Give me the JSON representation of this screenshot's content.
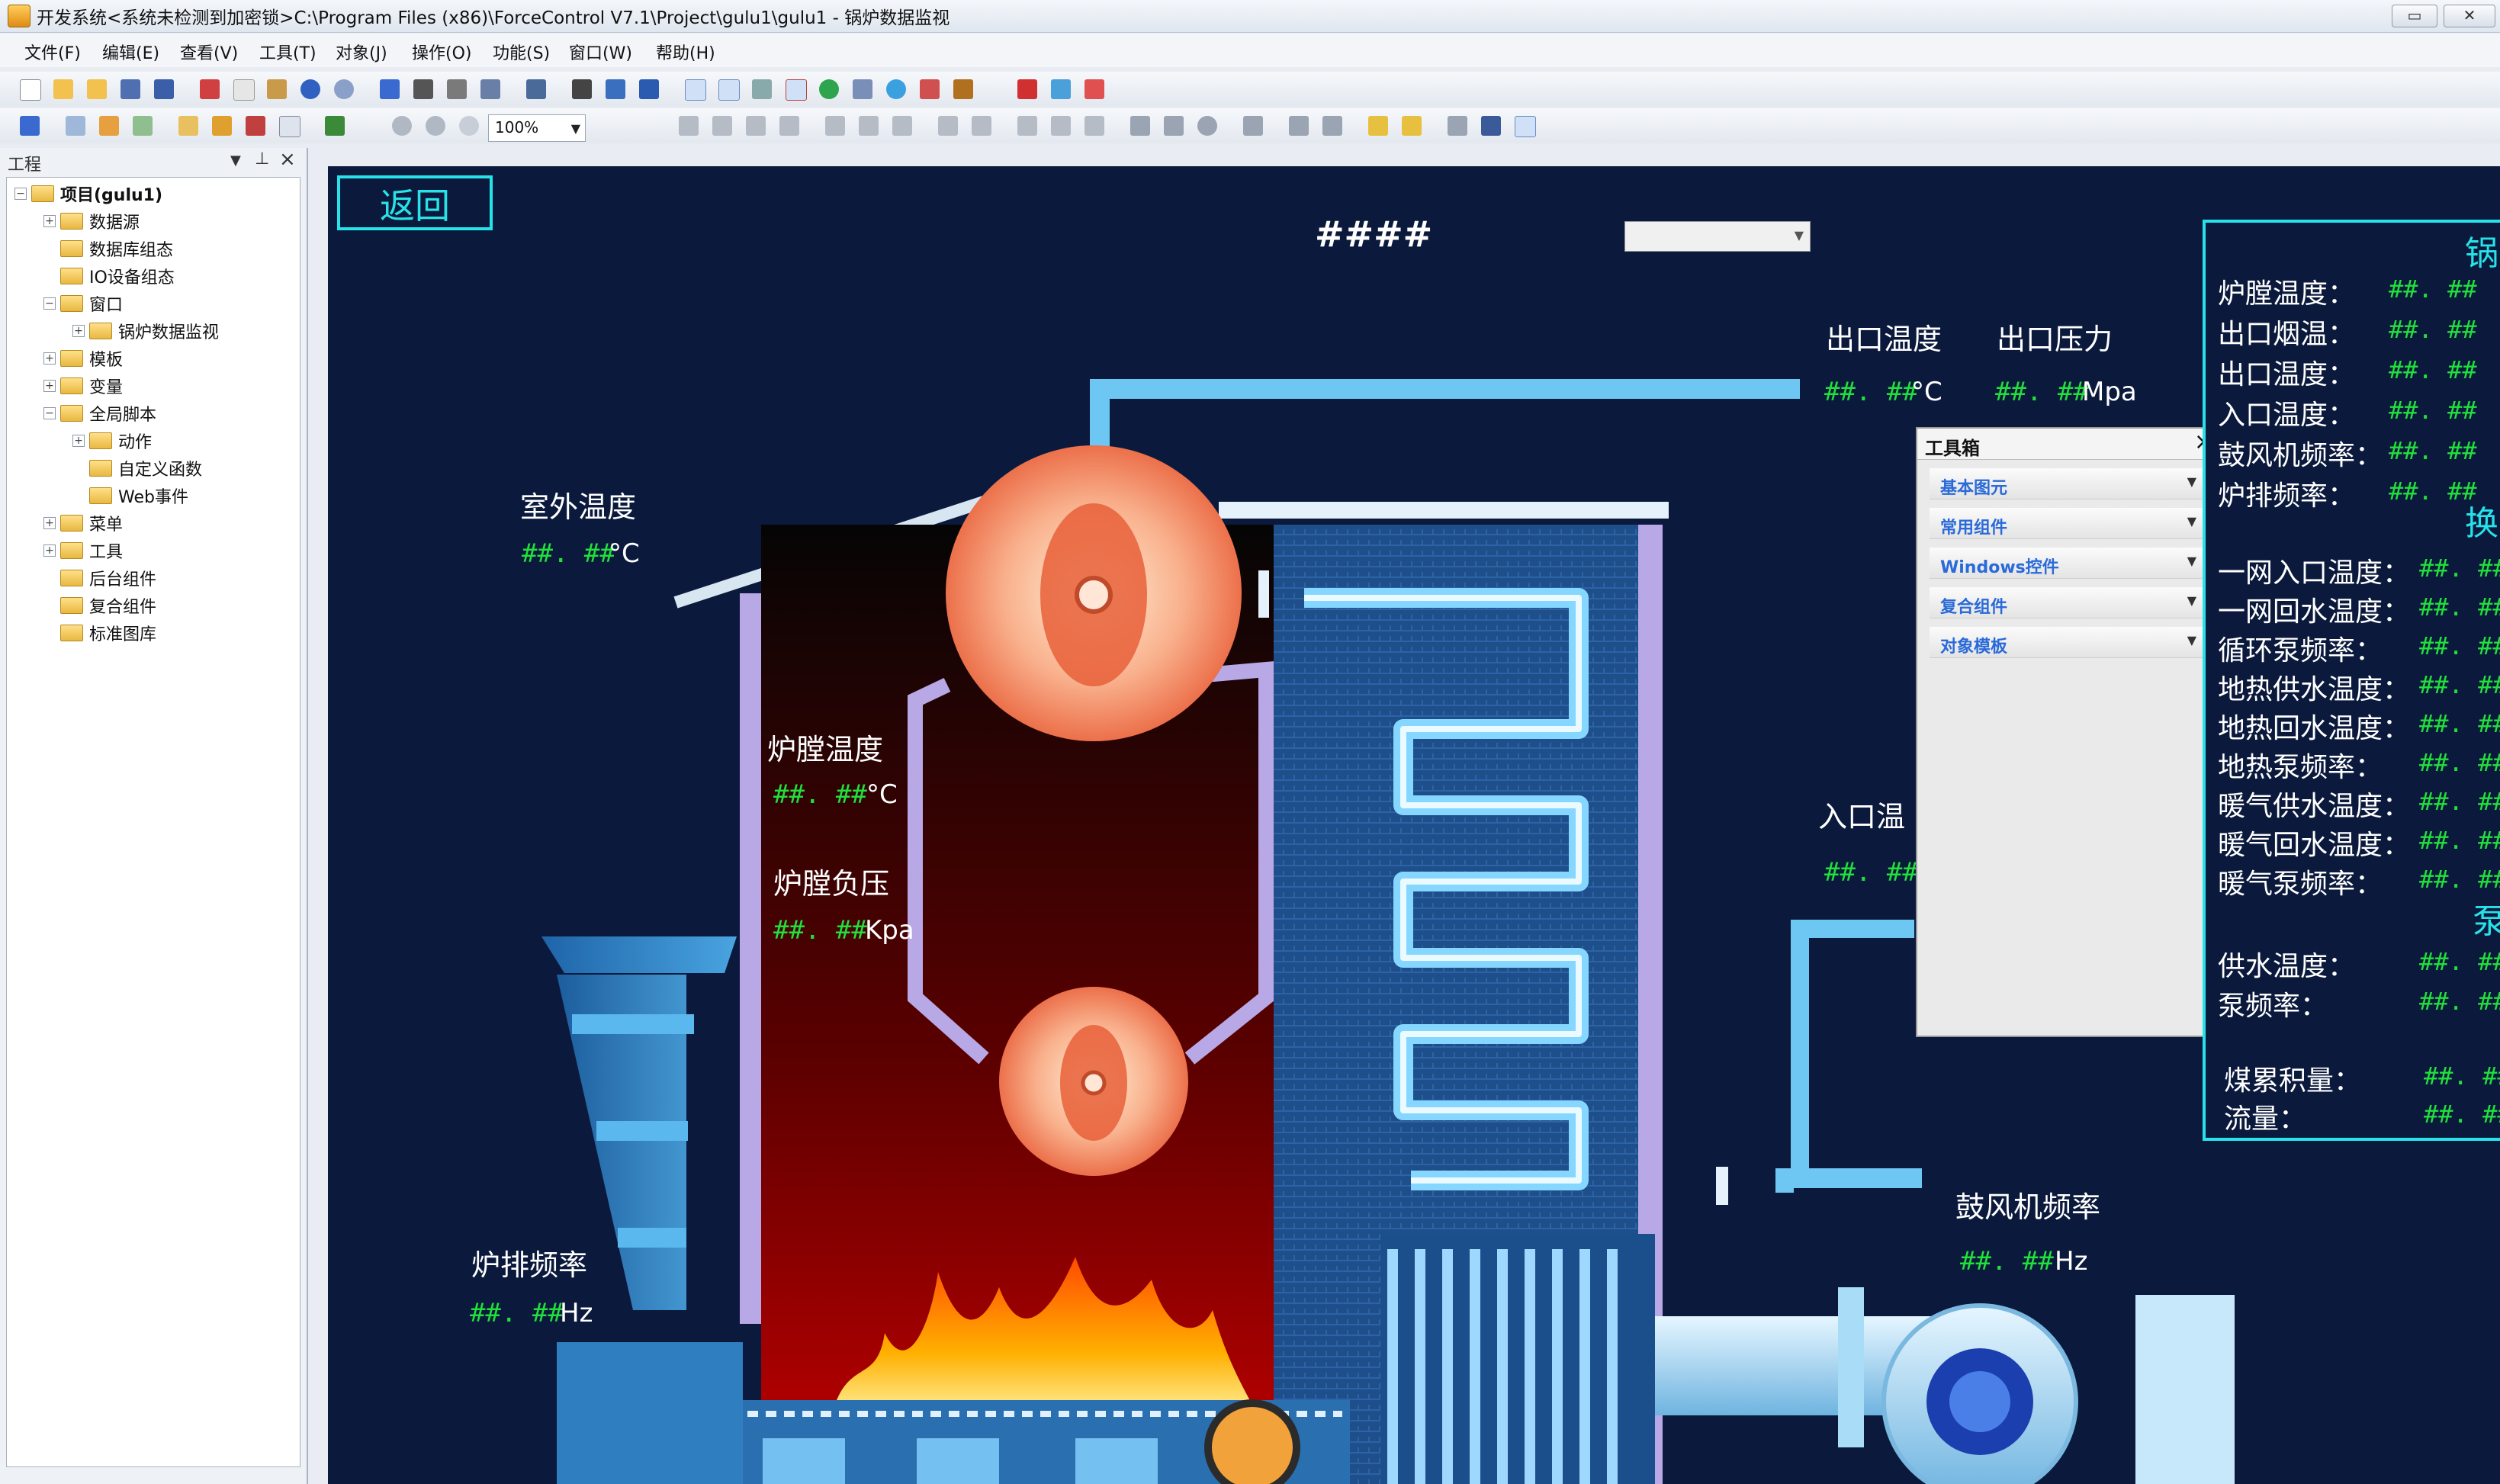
{
  "window": {
    "title": "开发系统<系统未检测到加密锁>C:\\Program Files (x86)\\ForceControl V7.1\\Project\\gulu1\\gulu1 - 锅炉数据监视",
    "minimize": "▭",
    "close": "✕"
  },
  "menu": [
    "文件(F)",
    "编辑(E)",
    "查看(V)",
    "工具(T)",
    "对象(J)",
    "操作(O)",
    "功能(S)",
    "窗口(W)",
    "帮助(H)"
  ],
  "toolbar": {
    "zoom": "100%"
  },
  "project_panel": {
    "title": "工程",
    "tree": [
      {
        "label": "项目(gulu1)",
        "level": 0,
        "exp": "−",
        "bold": true
      },
      {
        "label": "数据源",
        "level": 1,
        "exp": "+"
      },
      {
        "label": "数据库组态",
        "level": 1,
        "exp": ""
      },
      {
        "label": "IO设备组态",
        "level": 1,
        "exp": ""
      },
      {
        "label": "窗口",
        "level": 1,
        "exp": "−"
      },
      {
        "label": "锅炉数据监视",
        "level": 2,
        "exp": "+"
      },
      {
        "label": "模板",
        "level": 1,
        "exp": "+"
      },
      {
        "label": "变量",
        "level": 1,
        "exp": "+"
      },
      {
        "label": "全局脚本",
        "level": 1,
        "exp": "−"
      },
      {
        "label": "动作",
        "level": 2,
        "exp": "+"
      },
      {
        "label": "自定义函数",
        "level": 2,
        "exp": ""
      },
      {
        "label": "Web事件",
        "level": 2,
        "exp": ""
      },
      {
        "label": "菜单",
        "level": 1,
        "exp": "+"
      },
      {
        "label": "工具",
        "level": 1,
        "exp": "+"
      },
      {
        "label": "后台组件",
        "level": 1,
        "exp": ""
      },
      {
        "label": "复合组件",
        "level": 1,
        "exp": ""
      },
      {
        "label": "标准图库",
        "level": 1,
        "exp": ""
      }
    ]
  },
  "canvas": {
    "back_button": "返回",
    "header_value": "####",
    "outdoor_temp": {
      "label": "室外温度",
      "value": "##. ##",
      "unit": "°C"
    },
    "outlet_temp": {
      "label": "出口温度",
      "value": "##. ##",
      "unit": "°C"
    },
    "outlet_pressure": {
      "label": "出口压力",
      "value": "##. ##",
      "unit": "Mpa"
    },
    "furnace_temp": {
      "label": "炉膛温度",
      "value": "##. ##",
      "unit": "°C"
    },
    "furnace_pressure": {
      "label": "炉膛负压",
      "value": "##. ##",
      "unit": "Kpa"
    },
    "inlet_temp": {
      "label": "入口温",
      "value": "##. ##"
    },
    "grate_freq": {
      "label": "炉排频率",
      "value": "##. ##",
      "unit": "Hz"
    },
    "blower_freq": {
      "label": "鼓风机频率",
      "value": "##. ##",
      "unit": "Hz"
    }
  },
  "toolbox": {
    "title": "工具箱",
    "close": "×",
    "sections": [
      "基本图元",
      "常用组件",
      "Windows控件",
      "复合组件",
      "对象模板"
    ]
  },
  "info_panel": {
    "heading1": "锅",
    "group1": [
      {
        "label": "炉膛温度：",
        "value": "##. ##"
      },
      {
        "label": "出口烟温：",
        "value": "##. ##"
      },
      {
        "label": "出口温度：",
        "value": "##. ##"
      },
      {
        "label": "入口温度：",
        "value": "##. ##"
      },
      {
        "label": "鼓风机频率：",
        "value": "##. ##"
      },
      {
        "label": "炉排频率：",
        "value": "##. ##"
      }
    ],
    "heading2": "换",
    "group2": [
      {
        "label": "一网入口温度：",
        "value": "##. ##"
      },
      {
        "label": "一网回水温度：",
        "value": "##. ##"
      },
      {
        "label": "循环泵频率：",
        "value": "##. ##"
      },
      {
        "label": "地热供水温度：",
        "value": "##. ##"
      },
      {
        "label": "地热回水温度：",
        "value": "##. ##"
      },
      {
        "label": "地热泵频率：",
        "value": "##. ##"
      },
      {
        "label": "暖气供水温度：",
        "value": "##. ##"
      },
      {
        "label": "暖气回水温度：",
        "value": "##. ##"
      },
      {
        "label": "暖气泵频率：",
        "value": "##. ##"
      }
    ],
    "heading3": "泵",
    "group3": [
      {
        "label": "供水温度：",
        "value": "##. ##"
      },
      {
        "label": "泵频率：",
        "value": "##. ##"
      }
    ],
    "group4": [
      {
        "label": "煤累积量：",
        "value": "##. ##"
      },
      {
        "label": "流量：",
        "value": "##. ##"
      }
    ]
  },
  "colors": {
    "canvas_bg": "#0b1a3c",
    "value_green": "#22e03c",
    "accent_cyan": "#27e2e8",
    "pipe_blue": "#4fb6ec"
  }
}
